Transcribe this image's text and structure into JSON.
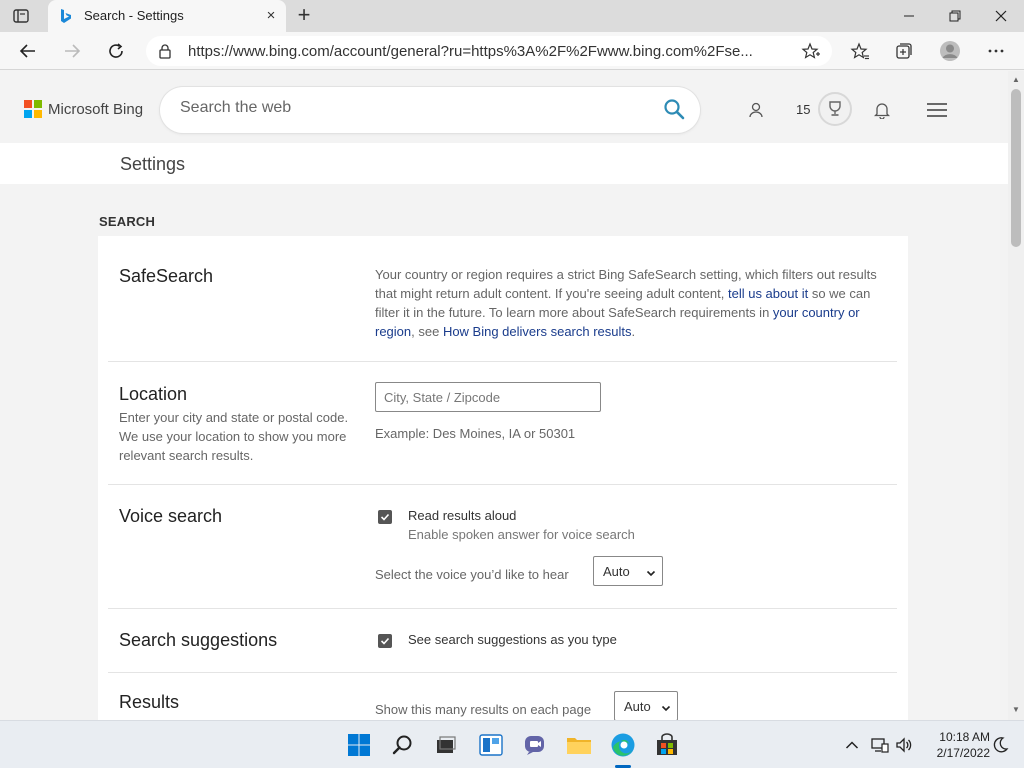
{
  "browser": {
    "tab_title": "Search - Settings",
    "tab_close": "×",
    "new_tab": "+",
    "url": "https://www.bing.com/account/general?ru=https%3A%2F%2Fwww.bing.com%2Fse..."
  },
  "header": {
    "logo_text": "Microsoft Bing",
    "search_placeholder": "Search the web",
    "rewards_count": "15"
  },
  "settings_title": "Settings",
  "section_label": "SEARCH",
  "safesearch": {
    "title": "SafeSearch",
    "text_1": "Your country or region requires a strict Bing SafeSearch setting, which filters out results that might return adult content. If you're seeing adult content, ",
    "link_1": "tell us about it",
    "text_2": " so we can filter it in the future. To learn more about SafeSearch requirements in ",
    "link_2": "your country or region",
    "text_3": ", see ",
    "link_3": "How Bing delivers search results",
    "text_4": "."
  },
  "location": {
    "title": "Location",
    "description": "Enter your city and state or postal code. We use your location to show you more relevant search results.",
    "placeholder": "City, State / Zipcode",
    "example": "Example: Des Moines, IA or 50301"
  },
  "voice_search": {
    "title": "Voice search",
    "checkbox_label": "Read results aloud",
    "checkbox_sub": "Enable spoken answer for voice search",
    "checked": true,
    "voice_prompt": "Select the voice you’d like to hear",
    "voice_value": "Auto"
  },
  "search_suggestions": {
    "title": "Search suggestions",
    "checkbox_label": "See search suggestions as you type",
    "checked": true
  },
  "results": {
    "title": "Results",
    "prompt": "Show this many results on each page",
    "value": "Auto"
  },
  "taskbar": {
    "time": "10:18 AM",
    "date": "2/17/2022"
  },
  "colors": {
    "accent": "#0067c0",
    "link": "#1a3c8c",
    "search_icon": "#2d8bb5"
  }
}
